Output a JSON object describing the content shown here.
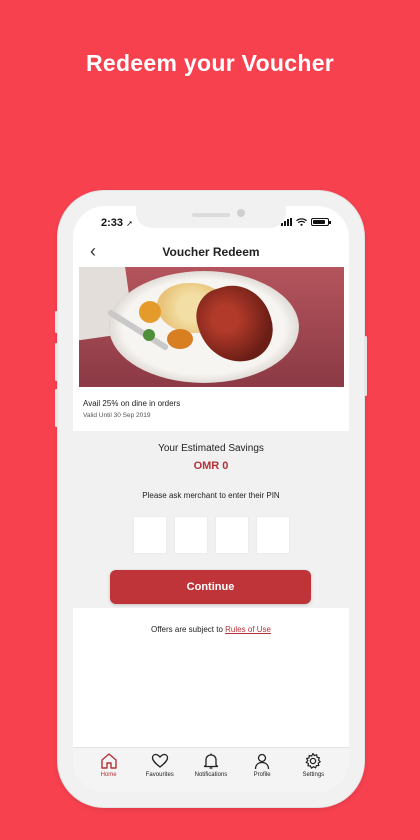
{
  "headline": "Redeem your Voucher",
  "status_bar": {
    "time": "2:33",
    "location_glyph": "➚"
  },
  "header": {
    "back": "‹",
    "title": "Voucher Redeem"
  },
  "offer": {
    "title": "Avail 25% on dine in orders",
    "valid_until": "Valid Until 30 Sep 2019"
  },
  "savings": {
    "label": "Your Estimated Savings",
    "value": "OMR 0"
  },
  "pin": {
    "prompt": "Please ask merchant to enter their PIN",
    "boxes": [
      "",
      "",
      "",
      ""
    ]
  },
  "continue_label": "Continue",
  "terms": {
    "text": "Offers are subject to",
    "link": "Rules of Use"
  },
  "tabs": [
    {
      "label": "Home",
      "icon": "home-icon",
      "active": true
    },
    {
      "label": "Favourites",
      "icon": "heart-icon",
      "active": false
    },
    {
      "label": "Notifications",
      "icon": "bell-icon",
      "active": false
    },
    {
      "label": "Profile",
      "icon": "user-icon",
      "active": false
    },
    {
      "label": "Settings",
      "icon": "gear-icon",
      "active": false
    }
  ],
  "colors": {
    "background": "#f7414f",
    "accent": "#bf3438",
    "savings_text": "#b3323a",
    "panel": "#f1f1f1"
  }
}
